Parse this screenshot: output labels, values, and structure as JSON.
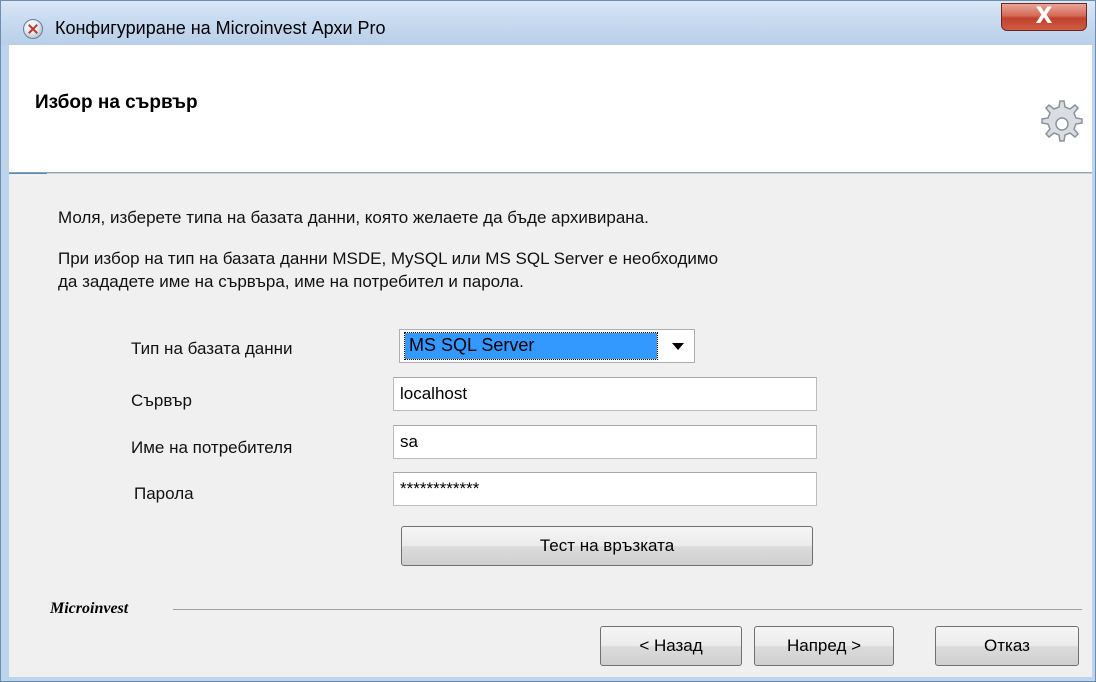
{
  "window": {
    "title": "Конфигуриране на Microinvest Архи Pro",
    "close_label": "X"
  },
  "header": {
    "title": "Избор на сървър"
  },
  "content": {
    "intro": "Моля, изберете типа на базата данни, която желаете да бъде архивирана.",
    "info_line1": "При избор на тип на базата данни MSDE, MySQL или MS SQL Server е необходимо",
    "info_line2": "да зададете име на сървъра, име на потребител и парола."
  },
  "form": {
    "db_type_label": "Тип на базата данни",
    "db_type_value": "MS SQL Server",
    "server_label": "Сървър",
    "server_value": "localhost",
    "user_label": "Име на потребителя",
    "user_value": "sa",
    "password_label": "Парола",
    "password_value": "************",
    "test_button": "Тест на връзката"
  },
  "footer": {
    "brand": "Microinvest",
    "back_button": "< Назад",
    "next_button": "Напред >",
    "cancel_button": "Отказ"
  },
  "colors": {
    "selection": "#3399ff",
    "accent": "#3c8fd6",
    "close_button": "#c1402c"
  },
  "icons": [
    "app-icon",
    "close-icon",
    "gear-icon",
    "dropdown-caret-icon"
  ]
}
